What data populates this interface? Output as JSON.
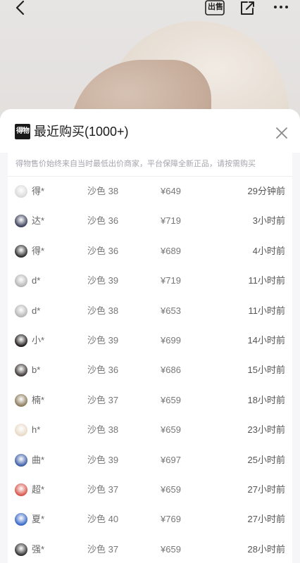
{
  "colors": {
    "accent_text": "#1a1a1a",
    "muted": "#a5a5ad",
    "sheet_bg": "#f6f6f8"
  },
  "top_bar": {
    "back_icon": "chevron-left-icon",
    "sell_label": "出售",
    "share_icon": "share-icon",
    "more_icon": "more-icon"
  },
  "sheet": {
    "brand_label": "得物",
    "title": "最近购买(1000+)",
    "close_icon": "close-icon",
    "notice": "得物售价始终来自当时最低出价商家，平台保障全新正品，请按需购买"
  },
  "purchases": [
    {
      "user": "得*",
      "size": "沙色 38",
      "price": "¥649",
      "time": "29分钟前",
      "avatar_color": "#d9d9d9"
    },
    {
      "user": "达*",
      "size": "沙色 36",
      "price": "¥719",
      "time": "3小时前",
      "avatar_color": "#3a3f58"
    },
    {
      "user": "得*",
      "size": "沙色 36",
      "price": "¥689",
      "time": "4小时前",
      "avatar_color": "#2b2b2b"
    },
    {
      "user": "d*",
      "size": "沙色 39",
      "price": "¥719",
      "time": "11小时前",
      "avatar_color": "#b5b5b5"
    },
    {
      "user": "d*",
      "size": "沙色 38",
      "price": "¥653",
      "time": "11小时前",
      "avatar_color": "#b5b5b5"
    },
    {
      "user": "小*",
      "size": "沙色 39",
      "price": "¥699",
      "time": "14小时前",
      "avatar_color": "#1f1a1a"
    },
    {
      "user": "b*",
      "size": "沙色 36",
      "price": "¥686",
      "time": "15小时前",
      "avatar_color": "#3d3535"
    },
    {
      "user": "楠*",
      "size": "沙色 37",
      "price": "¥659",
      "time": "18小时前",
      "avatar_color": "#8c7a5a"
    },
    {
      "user": "h*",
      "size": "沙色 38",
      "price": "¥659",
      "time": "23小时前",
      "avatar_color": "#e8d9c5"
    },
    {
      "user": "曲*",
      "size": "沙色 39",
      "price": "¥697",
      "time": "25小时前",
      "avatar_color": "#3b5ea8"
    },
    {
      "user": "超*",
      "size": "沙色 37",
      "price": "¥659",
      "time": "27小时前",
      "avatar_color": "#d8554a"
    },
    {
      "user": "夏*",
      "size": "沙色 40",
      "price": "¥769",
      "time": "27小时前",
      "avatar_color": "#3667c7"
    },
    {
      "user": "强*",
      "size": "沙色 37",
      "price": "¥659",
      "time": "28小时前",
      "avatar_color": "#2f2f2f"
    }
  ]
}
